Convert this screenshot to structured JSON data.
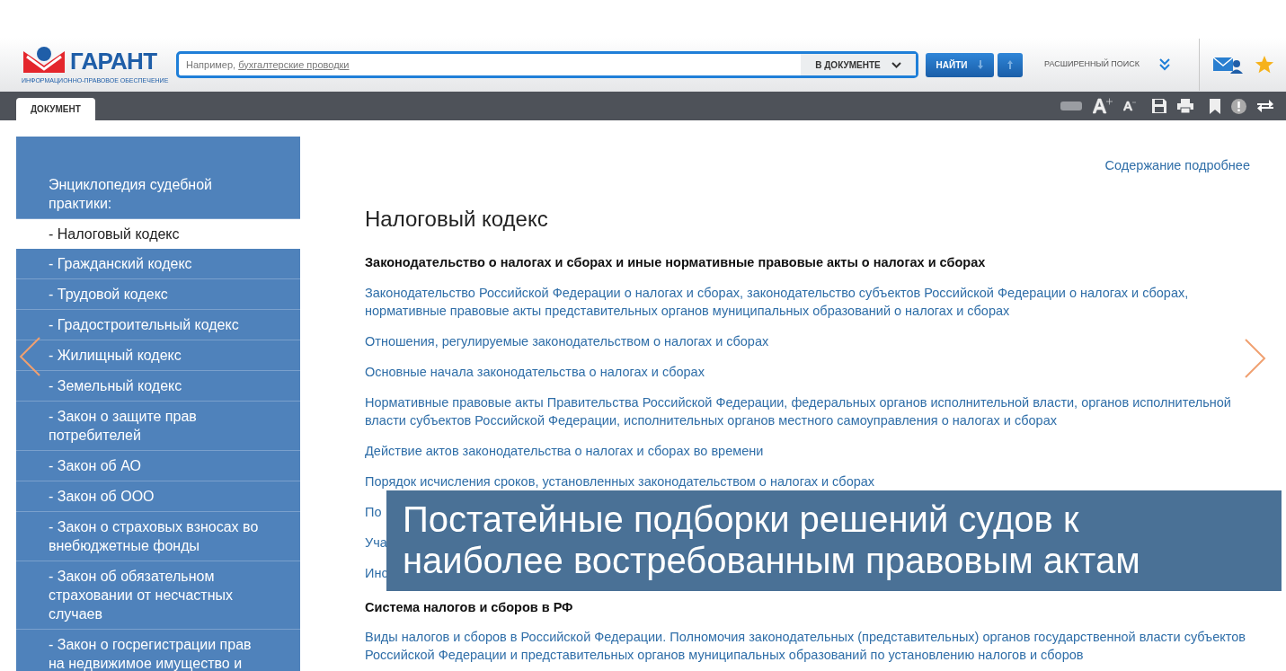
{
  "header": {
    "logo": {
      "name": "ГАРАНТ",
      "tagline": "ИНФОРМАЦИОННО-ПРАВОВОЕ ОБЕСПЕЧЕНИЕ"
    },
    "search": {
      "placeholder": "Например,",
      "example": "бухгалтерские проводки",
      "scope": "В ДОКУМЕНТЕ",
      "button": "НАЙТИ"
    },
    "advanced_search": "РАСШИРЕННЫЙ ПОИСК"
  },
  "tabs": [
    {
      "label": "ДОКУМЕНТ",
      "selected": true
    }
  ],
  "sidebar": {
    "title": "Энциклопедия судебной практики:",
    "items": [
      {
        "label": "- Налоговый кодекс",
        "selected": true
      },
      {
        "label": "- Гражданский кодекс",
        "selected": false
      },
      {
        "label": "- Трудовой кодекс",
        "selected": false
      },
      {
        "label": "- Градостроительный кодекс",
        "selected": false
      },
      {
        "label": "- Жилищный кодекс",
        "selected": false
      },
      {
        "label": "- Земельный кодекс",
        "selected": false
      },
      {
        "label": "- Закон о защите прав потребителей",
        "selected": false
      },
      {
        "label": "- Закон об АО",
        "selected": false
      },
      {
        "label": "- Закон об ООО",
        "selected": false
      },
      {
        "label": "- Закон о страховых взносах во внебюджетные фонды",
        "selected": false
      },
      {
        "label": "- Закон об обязательном страховании от несчастных случаев",
        "selected": false
      },
      {
        "label": "- Закон о госрегистрации прав на недвижимое имущество и",
        "selected": false
      }
    ]
  },
  "document": {
    "contents_link": "Содержание подробнее",
    "title": "Налоговый кодекс",
    "entries": [
      {
        "kind": "heading",
        "text": "Законодательство о налогах и сборах и иные нормативные правовые акты о налогах и сборах"
      },
      {
        "kind": "link",
        "text": "Законодательство Российской Федерации о налогах и сборах, законодательство субъектов Российской Федерации о налогах и сборах, нормативные правовые акты представительных органов муниципальных образований о налогах и сборах"
      },
      {
        "kind": "link",
        "text": "Отношения, регулируемые законодательством о налогах и сборах"
      },
      {
        "kind": "link",
        "text": "Основные начала законодательства о налогах и сборах"
      },
      {
        "kind": "link",
        "text": "Нормативные правовые акты Правительства Российской Федерации, федеральных органов исполнительной власти, органов исполнительной власти субъектов Российской Федерации, исполнительных органов местного самоуправления о налогах и сборах"
      },
      {
        "kind": "link",
        "text": "Действие актов законодательства о налогах и сборах во времени"
      },
      {
        "kind": "link",
        "text": "Порядок исчисления сроков, установленных законодательством о налогах и сборах"
      },
      {
        "kind": "link",
        "text": "По"
      },
      {
        "kind": "link",
        "text": "Уча"
      },
      {
        "kind": "link",
        "text": "Инс"
      },
      {
        "kind": "heading",
        "text": "Система налогов и сборов в РФ"
      },
      {
        "kind": "link",
        "text": "Виды налогов и сборов в Российской Федерации. Полномочия законодательных (представительных) органов государственной власти субъектов Российской Федерации и представительных органов муниципальных образований по установлению налогов и сборов"
      }
    ]
  },
  "caption": "Постатейные подборки решений судов к наиболее востребованным правовым актам"
}
